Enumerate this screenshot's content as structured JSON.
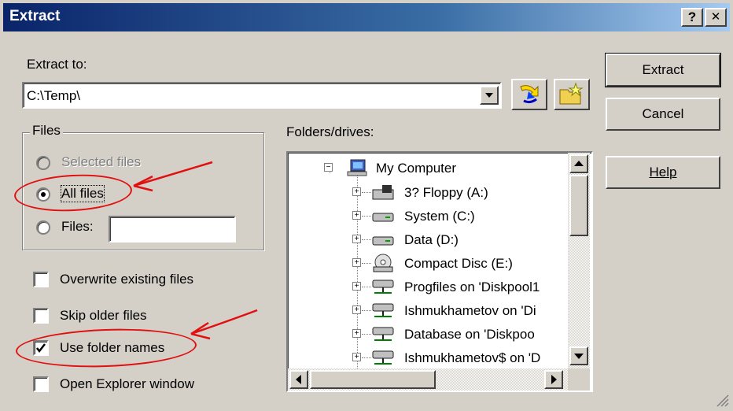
{
  "window": {
    "title": "Extract",
    "help_button": "?",
    "close_button": "✕"
  },
  "extract_to": {
    "label": "Extract to:",
    "value": "C:\\Temp\\"
  },
  "buttons": {
    "extract": "Extract",
    "cancel": "Cancel",
    "help": "Help"
  },
  "files_group": {
    "title": "Files",
    "selected_files": "Selected files",
    "all_files": "All files",
    "files_label": "Files:",
    "files_value": "",
    "selected_option": "All files"
  },
  "options": [
    {
      "label": "Overwrite existing files",
      "checked": false
    },
    {
      "label": "Skip older files",
      "checked": false
    },
    {
      "label": "Use folder names",
      "checked": true
    },
    {
      "label": "Open Explorer window",
      "checked": false
    }
  ],
  "folders": {
    "label": "Folders/drives:",
    "root": "My Computer",
    "items": [
      {
        "label": "3? Floppy (A:)",
        "icon": "floppy-drive-icon"
      },
      {
        "label": "System (C:)",
        "icon": "hard-drive-icon"
      },
      {
        "label": "Data (D:)",
        "icon": "hard-drive-icon"
      },
      {
        "label": "Compact Disc (E:)",
        "icon": "cd-drive-icon"
      },
      {
        "label": "Progfiles on 'Diskpool1",
        "icon": "network-drive-icon"
      },
      {
        "label": "Ishmukhametov on 'Di",
        "icon": "network-drive-icon"
      },
      {
        "label": "Database on 'Diskpoo",
        "icon": "network-drive-icon"
      },
      {
        "label": "Ishmukhametov$ on 'D",
        "icon": "network-drive-icon"
      }
    ]
  },
  "annotation_color": "#e01010",
  "titlebar_color": "#0a246a"
}
